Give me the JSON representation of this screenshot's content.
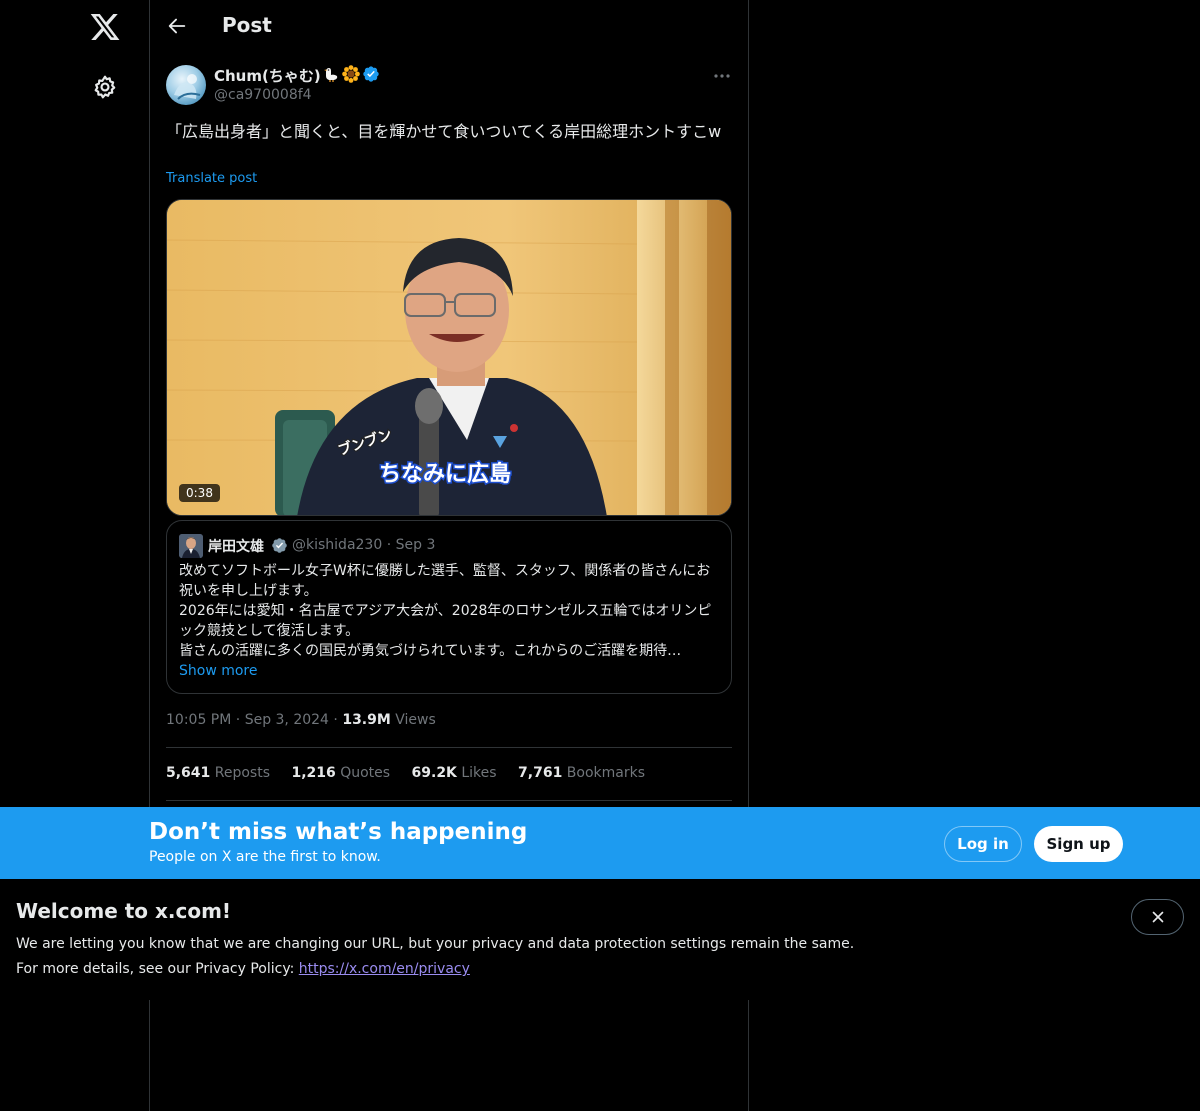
{
  "header": {
    "title": "Post"
  },
  "post": {
    "author_name": "Chum(ちゃむ)",
    "author_handle": "@ca970008f4",
    "text": "「広島出身者」と聞くと、目を輝かせて食いついてくる岸田総理ホントすこw",
    "translate_label": "Translate post",
    "video_duration": "0:38",
    "video_caption_main": "ちなみに広島",
    "video_caption_sfx": "ブンブン",
    "time": "10:05 PM",
    "date": "Sep 3, 2024",
    "views_count": "13.9M",
    "views_label": "Views"
  },
  "quote": {
    "name": "岸田文雄",
    "handle": "@kishida230",
    "date": "Sep 3",
    "lines": [
      "改めてソフトボール女子W杯に優勝した選手、監督、スタッフ、関係者の皆さんにお祝いを申し上げます。",
      "2026年には愛知・名古屋でアジア大会が、2028年のロサンゼルス五輪ではオリンピック競技として復活します。",
      "皆さんの活躍に多くの国民が勇気づけられています。これからのご活躍を期待…"
    ],
    "show_more": "Show more"
  },
  "stats": {
    "reposts_count": "5,641",
    "reposts_label": "Reposts",
    "quotes_count": "1,216",
    "quotes_label": "Quotes",
    "likes_count": "69.2K",
    "likes_label": "Likes",
    "bookmarks_count": "7,761",
    "bookmarks_label": "Bookmarks"
  },
  "banner": {
    "title": "Don’t miss what’s happening",
    "subtitle": "People on X are the first to know.",
    "login_label": "Log in",
    "signup_label": "Sign up"
  },
  "welcome": {
    "title": "Welcome to x.com!",
    "line1": "We are letting you know that we are changing our URL, but your privacy and data protection settings remain the same.",
    "line2_prefix": "For more details, see our Privacy Policy:",
    "link": "https://x.com/en/privacy"
  },
  "colors": {
    "background": "#000000",
    "accent": "#1d9bf0",
    "text": "#e7e9ea",
    "muted": "#71767b",
    "border": "#2f3336"
  },
  "icons": {
    "logo": "x-logo-icon",
    "settings": "gear-icon",
    "back": "arrow-left-icon",
    "more": "more-horizontal-icon",
    "verified": "verified-badge-icon",
    "close": "close-icon"
  }
}
